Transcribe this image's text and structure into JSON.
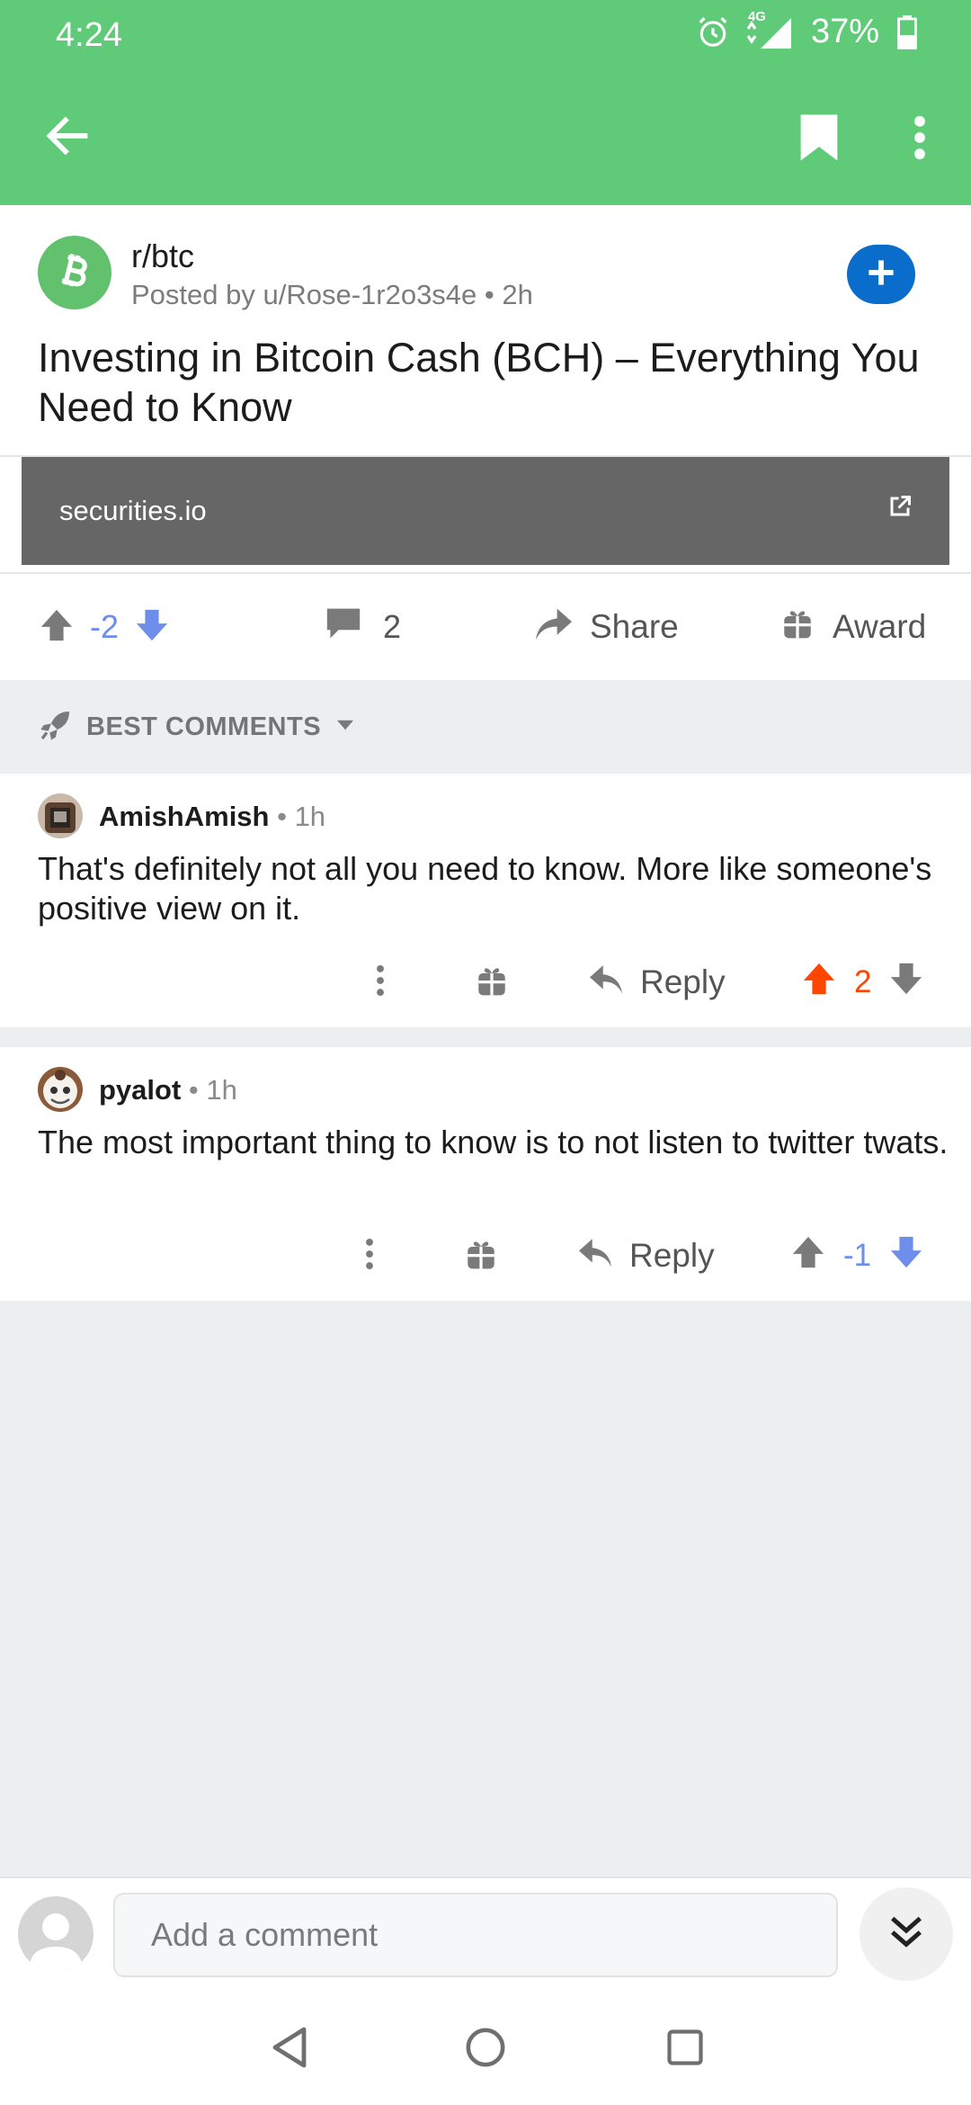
{
  "status_bar": {
    "time": "4:24",
    "network": "4G",
    "battery": "37%"
  },
  "app_bar": {
    "back_icon": "arrow-left-icon",
    "bookmark_icon": "bookmark-icon",
    "more_icon": "more-vertical-icon"
  },
  "post": {
    "subreddit": "r/btc",
    "meta": "Posted by u/Rose-1r2o3s4e • 2h",
    "title": "Investing in Bitcoin Cash (BCH) – Everything You Need to Know",
    "link_domain": "securities.io",
    "score": "-2",
    "comment_count": "2",
    "share_label": "Share",
    "award_label": "Award"
  },
  "sort": {
    "label": "BEST COMMENTS"
  },
  "comments": [
    {
      "author": "AmishAmish",
      "time": " • 1h",
      "body": "That's definitely not all you need to know. More like someone's positive view on it.",
      "reply_label": "Reply",
      "score": "2",
      "vote_state": "upvoted"
    },
    {
      "author": "pyalot",
      "time": " • 1h",
      "body": "The most important thing to know is to not listen to twitter twats.",
      "reply_label": "Reply",
      "score": "-1",
      "vote_state": "downvoted"
    }
  ],
  "compose": {
    "placeholder": "Add a comment"
  },
  "colors": {
    "header": "#5fcb79",
    "upvote": "#ff4500",
    "downvote": "#6d8eea",
    "join": "#0a6ccb"
  }
}
